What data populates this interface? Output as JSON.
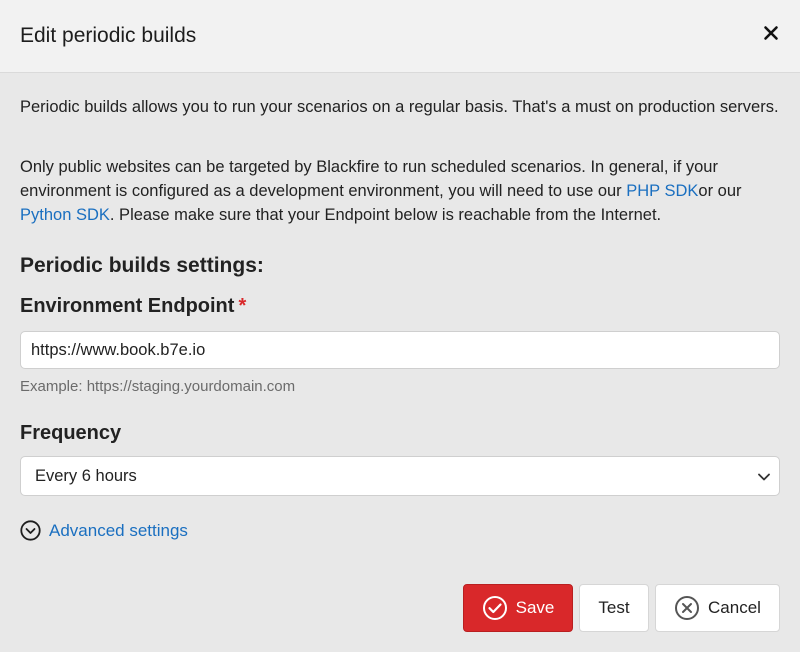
{
  "header": {
    "title": "Edit periodic builds"
  },
  "intro": {
    "paragraph1": "Periodic builds allows you to run your scenarios on a regular basis. That's a must on production servers.",
    "paragraph2_part1": "Only public websites can be targeted by Blackfire to run scheduled scenarios. In general, if your environment is configured as a development environment, you will need to use our ",
    "php_sdk_link": "PHP SDK",
    "paragraph2_part2": "or our ",
    "python_sdk_link": "Python SDK",
    "paragraph2_part3": ". Please make sure that your Endpoint below is reachable from the Internet."
  },
  "settings": {
    "title": "Periodic builds settings:",
    "endpoint_label": "Environment Endpoint",
    "required_mark": "*",
    "endpoint_value": "https://www.book.b7e.io",
    "endpoint_help": "Example: https://staging.yourdomain.com",
    "frequency_label": "Frequency",
    "frequency_value": "Every 6 hours",
    "advanced_label": "Advanced settings"
  },
  "actions": {
    "save_label": "Save",
    "test_label": "Test",
    "cancel_label": "Cancel"
  },
  "colors": {
    "accent_red": "#d9282a",
    "link_blue": "#1a6fc0",
    "header_bg": "#f2f2f2",
    "body_bg": "#e8e8e8"
  },
  "icons": {
    "close": "close-icon",
    "chevron_down": "chevron-down-icon",
    "advanced": "chevron-circle-down-icon",
    "save": "check-circle-icon",
    "cancel": "x-circle-icon"
  }
}
